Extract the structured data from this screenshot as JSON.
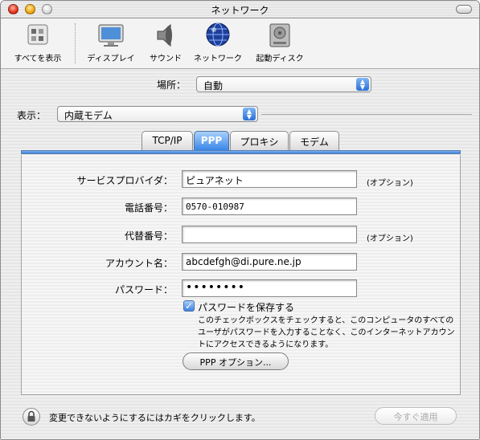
{
  "window": {
    "title": "ネットワーク"
  },
  "toolbar": {
    "items": [
      {
        "label": "すべてを表示",
        "icon": "show-all-icon"
      },
      {
        "label": "ディスプレイ",
        "icon": "display-icon"
      },
      {
        "label": "サウンド",
        "icon": "sound-icon"
      },
      {
        "label": "ネットワーク",
        "icon": "network-globe-icon"
      },
      {
        "label": "起動ディスク",
        "icon": "startup-disk-icon"
      }
    ]
  },
  "location": {
    "label": "場所：",
    "value": "自動"
  },
  "show": {
    "label": "表示：",
    "value": "内蔵モデム"
  },
  "tabs": [
    {
      "label": "TCP/IP",
      "active": false
    },
    {
      "label": "PPP",
      "active": true
    },
    {
      "label": "プロキシ",
      "active": false
    },
    {
      "label": "モデム",
      "active": false
    }
  ],
  "form": {
    "provider": {
      "label": "サービスプロバイダ：",
      "value": "ピュアネット",
      "note": "(オプション)"
    },
    "phone": {
      "label": "電話番号：",
      "value": "0570-010987"
    },
    "alt_phone": {
      "label": "代替番号：",
      "value": "",
      "note": "(オプション)"
    },
    "account": {
      "label": "アカウント名：",
      "value": "abcdefgh@di.pure.ne.jp"
    },
    "password": {
      "label": "パスワード：",
      "value": "••••••••"
    },
    "save_password": {
      "label": "パスワードを保存する",
      "checked": true,
      "help": "このチェックボックスをチェックすると、このコンピュータのすべてのユーザがパスワードを入力することなく、このインターネットアカウントにアクセスできるようになります。"
    },
    "ppp_options_button": "PPP オプション..."
  },
  "footer": {
    "lock_text": "変更できないようにするにはカギをクリックします。",
    "apply_button": "今すぐ適用"
  }
}
